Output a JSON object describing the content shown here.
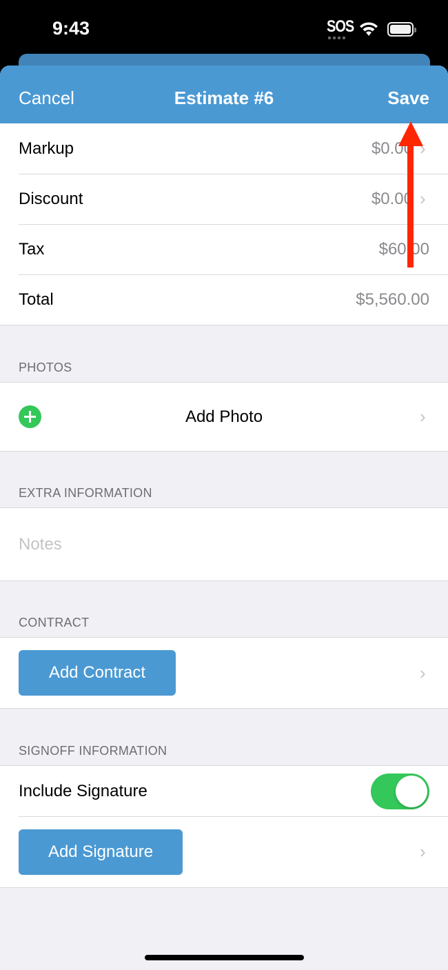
{
  "status_bar": {
    "time": "9:43",
    "carrier": "SOS"
  },
  "nav": {
    "cancel_label": "Cancel",
    "title": "Estimate #6",
    "save_label": "Save"
  },
  "summary": {
    "rows": [
      {
        "label": "Markup",
        "value": "$0.00",
        "has_chevron": true
      },
      {
        "label": "Discount",
        "value": "$0.00",
        "has_chevron": true
      },
      {
        "label": "Tax",
        "value": "$60.00",
        "has_chevron": false
      },
      {
        "label": "Total",
        "value": "$5,560.00",
        "has_chevron": false
      }
    ]
  },
  "photos": {
    "header": "PHOTOS",
    "add_label": "Add Photo"
  },
  "extra": {
    "header": "EXTRA INFORMATION",
    "notes_placeholder": "Notes"
  },
  "contract": {
    "header": "CONTRACT",
    "button_label": "Add Contract"
  },
  "signoff": {
    "header": "SIGNOFF INFORMATION",
    "include_label": "Include Signature",
    "include_on": true,
    "button_label": "Add Signature"
  },
  "colors": {
    "accent": "#4a99d3",
    "toggle_on": "#34c759",
    "annotation_arrow": "#ff2600"
  }
}
